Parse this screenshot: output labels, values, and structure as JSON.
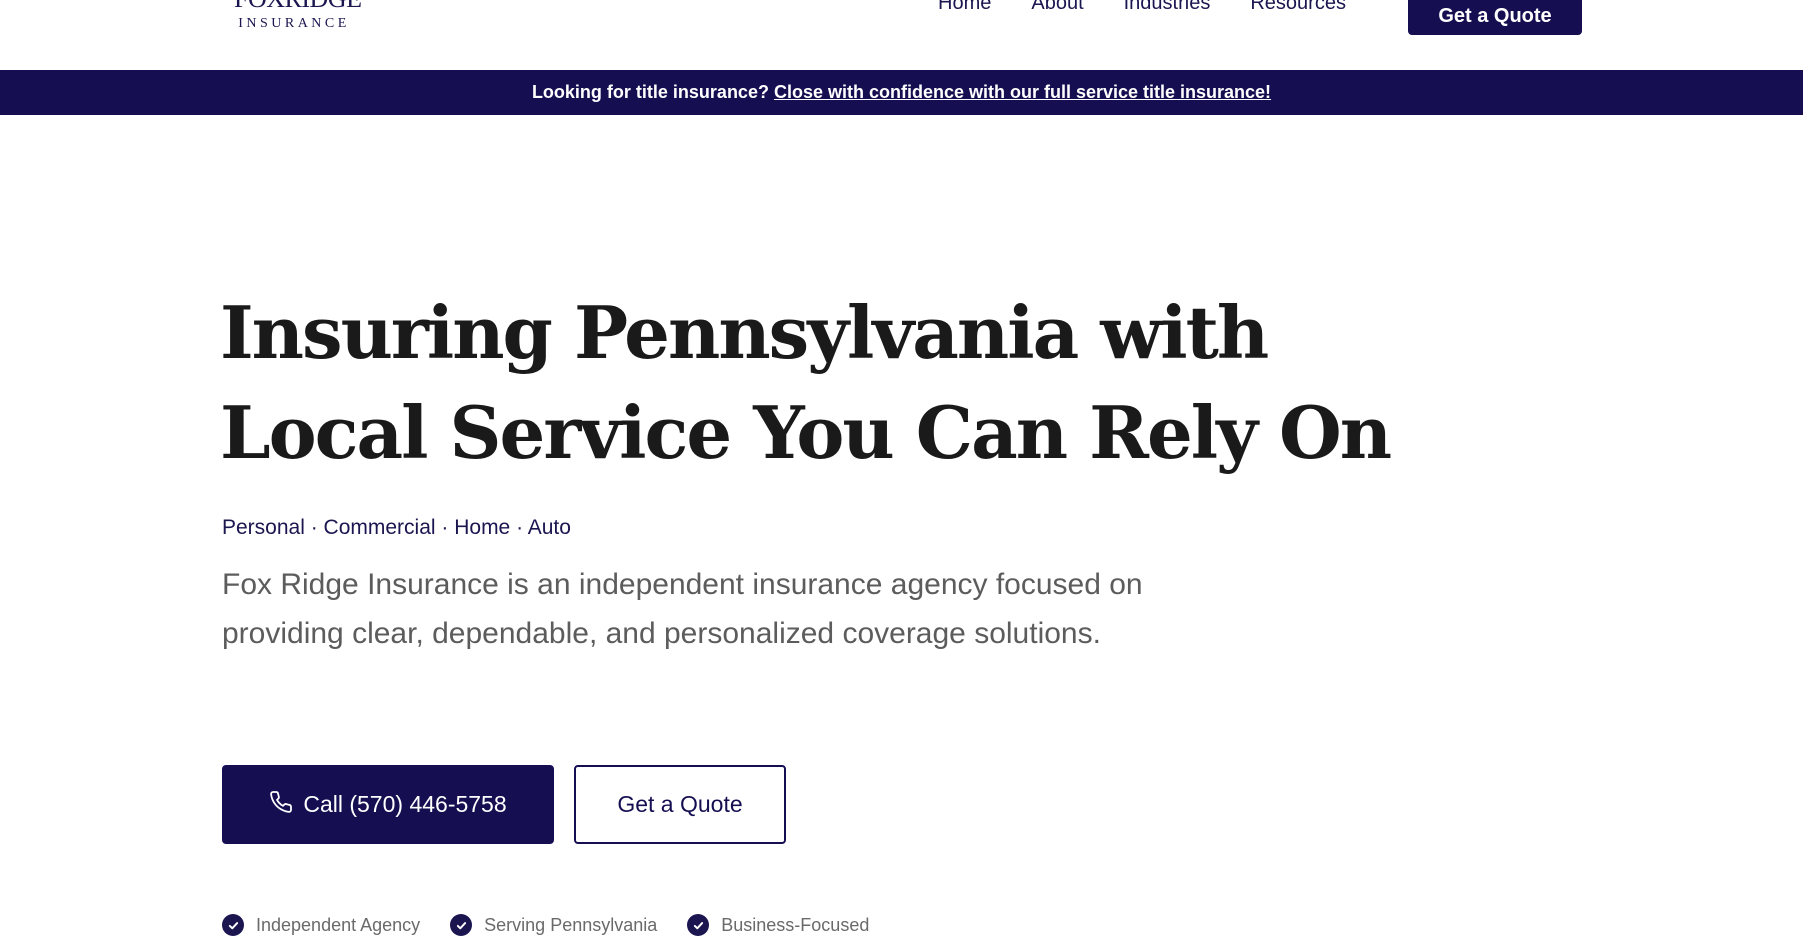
{
  "header": {
    "logo": {
      "top": "FOXRIDGE",
      "bottom": "INSURANCE"
    },
    "nav": [
      "Home",
      "About",
      "Industries",
      "Resources"
    ],
    "cta": "Get a Quote"
  },
  "banner": {
    "text": "Looking for title insurance?",
    "link": "Close with confidence with our full service title insurance!"
  },
  "hero": {
    "title_line1": "Insuring Pennsylvania with",
    "title_line2": "Local Service You Can Rely On",
    "categories": "Personal · Commercial · Home · Auto",
    "description": "Fox Ridge Insurance is an independent insurance agency focused on providing clear, dependable, and personalized coverage solutions.",
    "call_button": "Call (570) 446-5758",
    "quote_button": "Get a Quote",
    "features": [
      "Independent Agency",
      "Serving Pennsylvania",
      "Business-Focused"
    ]
  },
  "colors": {
    "primary": "#150f52",
    "text_dark": "#1a1a1a",
    "text_muted": "#5c5c5c",
    "background": "#ffffff"
  },
  "icons": {
    "phone": "phone-icon",
    "check": "check-circle-icon"
  }
}
